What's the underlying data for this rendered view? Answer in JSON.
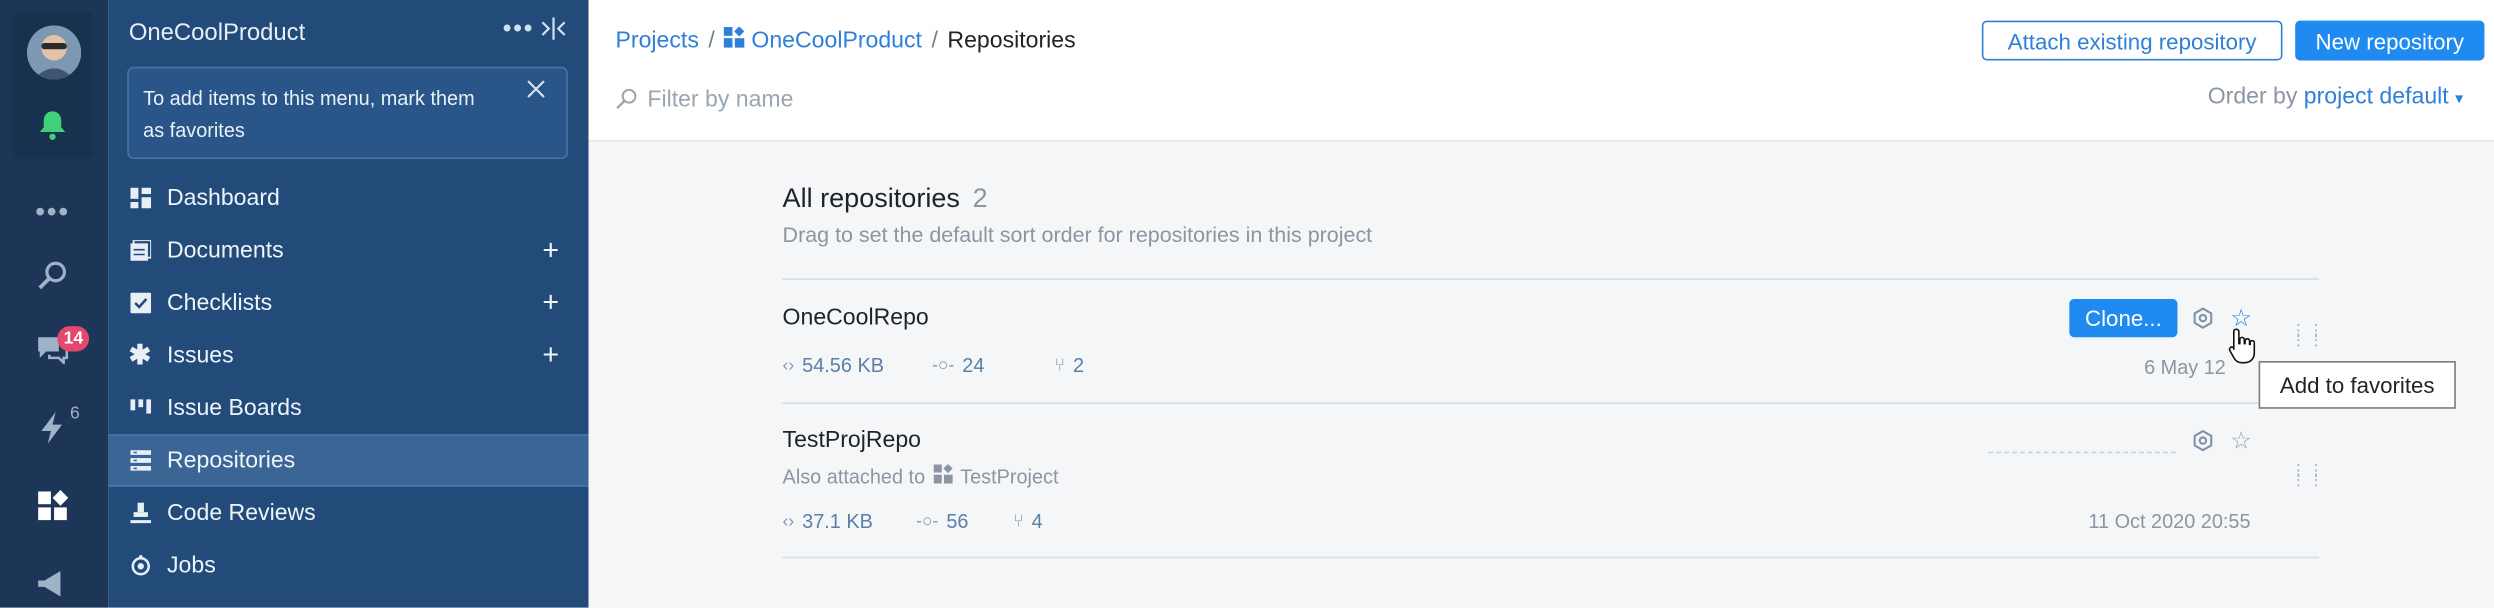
{
  "rail": {
    "notifications_badge": "14",
    "automation_count": "6"
  },
  "sidebar": {
    "title": "OneCoolProduct",
    "hint": "To add items to this menu, mark them as favorites",
    "items": [
      {
        "label": "Dashboard",
        "icon": "dashboard-icon",
        "has_add": false
      },
      {
        "label": "Documents",
        "icon": "documents-icon",
        "has_add": true
      },
      {
        "label": "Checklists",
        "icon": "checklists-icon",
        "has_add": true
      },
      {
        "label": "Issues",
        "icon": "issues-icon",
        "has_add": true
      },
      {
        "label": "Issue Boards",
        "icon": "boards-icon",
        "has_add": false
      },
      {
        "label": "Repositories",
        "icon": "repositories-icon",
        "has_add": false,
        "active": true
      },
      {
        "label": "Code Reviews",
        "icon": "code-reviews-icon",
        "has_add": false
      },
      {
        "label": "Jobs",
        "icon": "jobs-icon",
        "has_add": false
      }
    ]
  },
  "header": {
    "breadcrumb": [
      "Projects",
      "OneCoolProduct",
      "Repositories"
    ],
    "attach_label": "Attach existing repository",
    "new_label": "New repository",
    "filter_placeholder": "Filter by name",
    "order_label": "Order by",
    "order_value": "project default"
  },
  "main": {
    "section_title": "All repositories",
    "section_count": "2",
    "section_subtitle": "Drag to set the default sort order for repositories in this project",
    "repos": [
      {
        "name": "OneCoolRepo",
        "size": "54.56 KB",
        "commits": "24",
        "branches": "2",
        "date": "6 May 12",
        "clone_label": "Clone..."
      },
      {
        "name": "TestProjRepo",
        "also_label": "Also attached to",
        "also_project": "TestProject",
        "size": "37.1 KB",
        "commits": "56",
        "branches": "4",
        "date": "11 Oct 2020 20:55"
      }
    ],
    "tooltip": "Add to favorites"
  },
  "colors": {
    "rail_bg": "#1d3557",
    "sidebar_bg": "#234b7a",
    "accent": "#1f8af0",
    "link": "#2e7fd8",
    "badge": "#e5486d"
  }
}
